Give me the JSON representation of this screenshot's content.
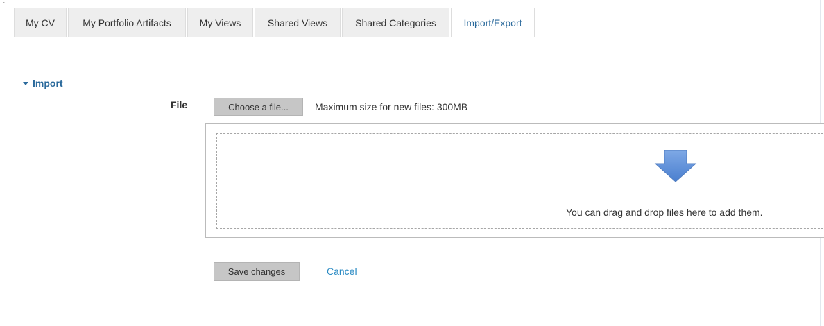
{
  "tabs": [
    {
      "label": "My CV",
      "active": false
    },
    {
      "label": "My Portfolio Artifacts",
      "active": false
    },
    {
      "label": "My Views",
      "active": false
    },
    {
      "label": "Shared Views",
      "active": false
    },
    {
      "label": "Shared Categories",
      "active": false
    },
    {
      "label": "Import/Export",
      "active": true
    }
  ],
  "import_section": {
    "title": "Import",
    "file_label": "File",
    "choose_button": "Choose a file...",
    "max_size_text": "Maximum size for new files: 300MB",
    "dropzone_text": "You can drag and drop files here to add them."
  },
  "actions": {
    "save_label": "Save changes",
    "cancel_label": "Cancel"
  },
  "colors": {
    "accent": "#2b6a9c",
    "link": "#2b8bc4",
    "button_bg": "#c6c6c6",
    "arrow": "#5b8ed6"
  }
}
